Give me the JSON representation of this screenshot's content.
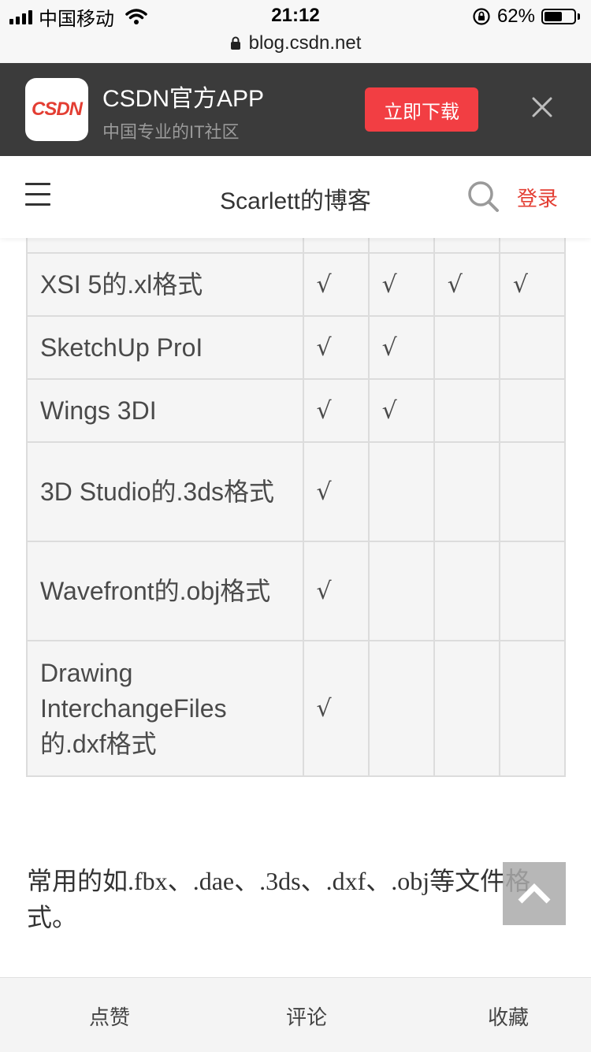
{
  "status_bar": {
    "carrier": "中国移动",
    "time": "21:12",
    "battery_percent": "62%",
    "battery_level": 0.62,
    "url": "blog.csdn.net"
  },
  "app_banner": {
    "logo_text": "CSDN",
    "name": "CSDN官方APP",
    "description": "中国专业的IT社区",
    "download_label": "立即下载"
  },
  "header": {
    "title": "Scarlett的博客",
    "login_label": "登录"
  },
  "table": {
    "rows": [
      {
        "name": "",
        "marks": [
          "",
          "",
          "",
          ""
        ]
      },
      {
        "name": "XSI 5的.xl格式",
        "marks": [
          "√",
          "√",
          "√",
          "√"
        ]
      },
      {
        "name": "SketchUp ProI",
        "marks": [
          "√",
          "√",
          "",
          ""
        ]
      },
      {
        "name": "Wings 3DI",
        "marks": [
          "√",
          "√",
          "",
          ""
        ]
      },
      {
        "name": "3D Studio的.3ds格式",
        "marks": [
          "√",
          "",
          "",
          ""
        ]
      },
      {
        "name": "Wavefront的.obj格式",
        "marks": [
          "√",
          "",
          "",
          ""
        ]
      },
      {
        "name": "Drawing InterchangeFiles的.dxf格式",
        "marks": [
          "√",
          "",
          "",
          ""
        ]
      }
    ]
  },
  "paragraph": {
    "p1": "常用的如",
    "p2": ".fbx",
    "p3": "、",
    "p4": ".dae",
    "p5": "、",
    "p6": ".3ds",
    "p7": "、",
    "p8": ".dxf",
    "p9": "、",
    "p10": ".obj",
    "p11": "等文件格式。"
  },
  "bottom_bar": {
    "like": "点赞",
    "comment": "评论",
    "collect": "收藏"
  },
  "colors": {
    "accent_red": "#e33e33",
    "download_red": "#f23e43",
    "banner_bg": "#3b3b3b"
  }
}
